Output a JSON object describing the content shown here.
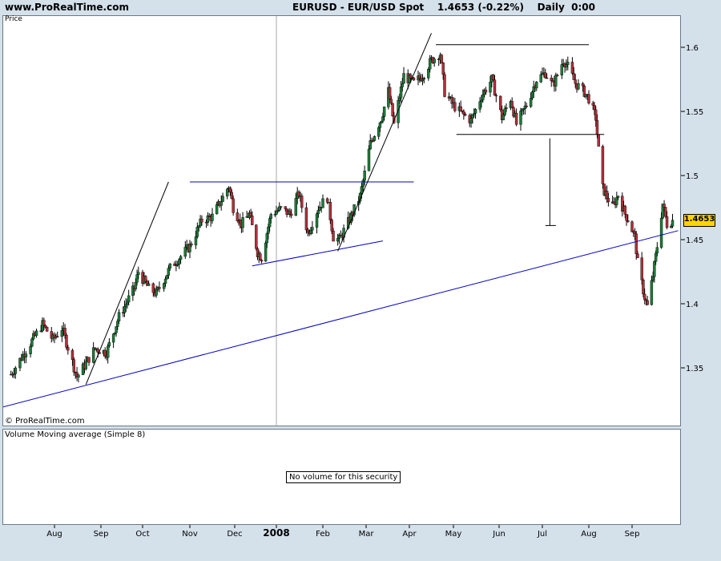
{
  "header": {
    "site": "www.ProRealTime.com",
    "title": "EURUSD - EUR/USD Spot    1.4653 (-0.22%)    Daily  0:00"
  },
  "price_panel": {
    "label": "Price",
    "copyright": "© ProRealTime.com"
  },
  "volume_panel": {
    "title": "Volume Moving average (Simple 8)",
    "message": "No volume for this security"
  },
  "last_price": "1.4653",
  "colors": {
    "background": "#d4e0ea",
    "panel": "#ffffff",
    "up_candle": "#1f7a3a",
    "down_candle": "#b0303a",
    "wick": "#000000",
    "blue_trendline": "#0000c8",
    "black_trendline": "#000000",
    "badge": "#ffd400"
  },
  "chart_data": {
    "type": "candlestick",
    "symbol": "EURUSD",
    "interval": "Daily",
    "ylim": [
      1.305,
      1.625
    ],
    "yticks": [
      1.35,
      1.4,
      1.45,
      1.5,
      1.55,
      1.6
    ],
    "ytick_labels": [
      "1.35",
      "1.4",
      "1.45",
      "1.5",
      "1.55",
      "1.6"
    ],
    "x_labels": [
      "Aug",
      "Sep",
      "Oct",
      "Nov",
      "Dec",
      "2008",
      "Feb",
      "Mar",
      "Apr",
      "May",
      "Jun",
      "Jul",
      "Aug",
      "Sep"
    ],
    "x_label_dates": [
      "2007-08-01",
      "2007-09-01",
      "2007-10-01",
      "2007-11-01",
      "2007-12-01",
      "2008-01-01",
      "2008-02-01",
      "2008-03-01",
      "2008-04-01",
      "2008-05-01",
      "2008-06-01",
      "2008-07-01",
      "2008-08-01",
      "2008-09-01"
    ],
    "year_divider": "2008-01-01",
    "date_range": [
      "2007-07-03",
      "2008-09-30"
    ],
    "price_path": [
      [
        "2007-07-03",
        1.345
      ],
      [
        "2007-07-12",
        1.362
      ],
      [
        "2007-07-24",
        1.384
      ],
      [
        "2007-07-31",
        1.372
      ],
      [
        "2007-08-06",
        1.381
      ],
      [
        "2007-08-10",
        1.366
      ],
      [
        "2007-08-16",
        1.343
      ],
      [
        "2007-08-20",
        1.35
      ],
      [
        "2007-08-28",
        1.365
      ],
      [
        "2007-09-05",
        1.362
      ],
      [
        "2007-09-14",
        1.39
      ],
      [
        "2007-09-25",
        1.412
      ],
      [
        "2007-09-28",
        1.425
      ],
      [
        "2007-10-05",
        1.412
      ],
      [
        "2007-10-10",
        1.408
      ],
      [
        "2007-10-19",
        1.428
      ],
      [
        "2007-10-26",
        1.437
      ],
      [
        "2007-11-01",
        1.445
      ],
      [
        "2007-11-09",
        1.465
      ],
      [
        "2007-11-16",
        1.468
      ],
      [
        "2007-11-23",
        1.483
      ],
      [
        "2007-11-27",
        1.492
      ],
      [
        "2007-11-30",
        1.475
      ],
      [
        "2007-12-06",
        1.462
      ],
      [
        "2007-12-12",
        1.47
      ],
      [
        "2007-12-18",
        1.44
      ],
      [
        "2007-12-21",
        1.436
      ],
      [
        "2007-12-28",
        1.47
      ],
      [
        "2008-01-04",
        1.474
      ],
      [
        "2008-01-10",
        1.47
      ],
      [
        "2008-01-16",
        1.486
      ],
      [
        "2008-01-22",
        1.455
      ],
      [
        "2008-01-29",
        1.475
      ],
      [
        "2008-02-04",
        1.483
      ],
      [
        "2008-02-08",
        1.452
      ],
      [
        "2008-02-12",
        1.45
      ],
      [
        "2008-02-19",
        1.466
      ],
      [
        "2008-02-26",
        1.484
      ],
      [
        "2008-03-04",
        1.525
      ],
      [
        "2008-03-12",
        1.545
      ],
      [
        "2008-03-17",
        1.566
      ],
      [
        "2008-03-21",
        1.54
      ],
      [
        "2008-03-28",
        1.578
      ],
      [
        "2008-04-04",
        1.572
      ],
      [
        "2008-04-10",
        1.578
      ],
      [
        "2008-04-16",
        1.59
      ],
      [
        "2008-04-22",
        1.595
      ],
      [
        "2008-04-25",
        1.565
      ],
      [
        "2008-04-30",
        1.556
      ],
      [
        "2008-05-07",
        1.548
      ],
      [
        "2008-05-13",
        1.543
      ],
      [
        "2008-05-20",
        1.562
      ],
      [
        "2008-05-27",
        1.575
      ],
      [
        "2008-06-03",
        1.545
      ],
      [
        "2008-06-09",
        1.56
      ],
      [
        "2008-06-13",
        1.54
      ],
      [
        "2008-06-20",
        1.555
      ],
      [
        "2008-06-27",
        1.575
      ],
      [
        "2008-07-03",
        1.58
      ],
      [
        "2008-07-08",
        1.57
      ],
      [
        "2008-07-15",
        1.59
      ],
      [
        "2008-07-18",
        1.585
      ],
      [
        "2008-07-23",
        1.572
      ],
      [
        "2008-07-29",
        1.565
      ],
      [
        "2008-08-01",
        1.56
      ],
      [
        "2008-08-06",
        1.545
      ],
      [
        "2008-08-08",
        1.52
      ],
      [
        "2008-08-11",
        1.49
      ],
      [
        "2008-08-18",
        1.475
      ],
      [
        "2008-08-22",
        1.485
      ],
      [
        "2008-08-27",
        1.47
      ],
      [
        "2008-08-29",
        1.466
      ],
      [
        "2008-09-03",
        1.452
      ],
      [
        "2008-09-05",
        1.432
      ],
      [
        "2008-09-10",
        1.405
      ],
      [
        "2008-09-12",
        1.398
      ],
      [
        "2008-09-16",
        1.422
      ],
      [
        "2008-09-19",
        1.445
      ],
      [
        "2008-09-23",
        1.478
      ],
      [
        "2008-09-26",
        1.462
      ],
      [
        "2008-09-30",
        1.465
      ]
    ],
    "trendlines": [
      {
        "color": "blue",
        "from": [
          "2007-06-26",
          1.319
        ],
        "to": [
          "2008-10-04",
          1.457
        ]
      },
      {
        "color": "blue",
        "from": [
          "2007-11-01",
          1.495
        ],
        "to": [
          "2008-04-04",
          1.495
        ]
      },
      {
        "color": "blue",
        "from": [
          "2007-12-14",
          1.4295
        ],
        "to": [
          "2008-03-13",
          1.449
        ]
      },
      {
        "color": "black",
        "from": [
          "2007-08-22",
          1.337
        ],
        "to": [
          "2007-10-18",
          1.495
        ]
      },
      {
        "color": "black",
        "from": [
          "2008-02-11",
          1.441
        ],
        "to": [
          "2008-04-16",
          1.611
        ]
      },
      {
        "color": "black",
        "from": [
          "2008-04-19",
          1.602
        ],
        "to": [
          "2008-08-01",
          1.602
        ]
      },
      {
        "color": "black",
        "from": [
          "2008-05-03",
          1.532
        ],
        "to": [
          "2008-08-12",
          1.532
        ]
      },
      {
        "color": "black",
        "from": [
          "2008-07-06",
          1.529
        ],
        "to": [
          "2008-07-06",
          1.461
        ]
      },
      {
        "color": "black",
        "from": [
          "2008-07-03",
          1.461
        ],
        "to": [
          "2008-07-10",
          1.461
        ]
      }
    ]
  }
}
